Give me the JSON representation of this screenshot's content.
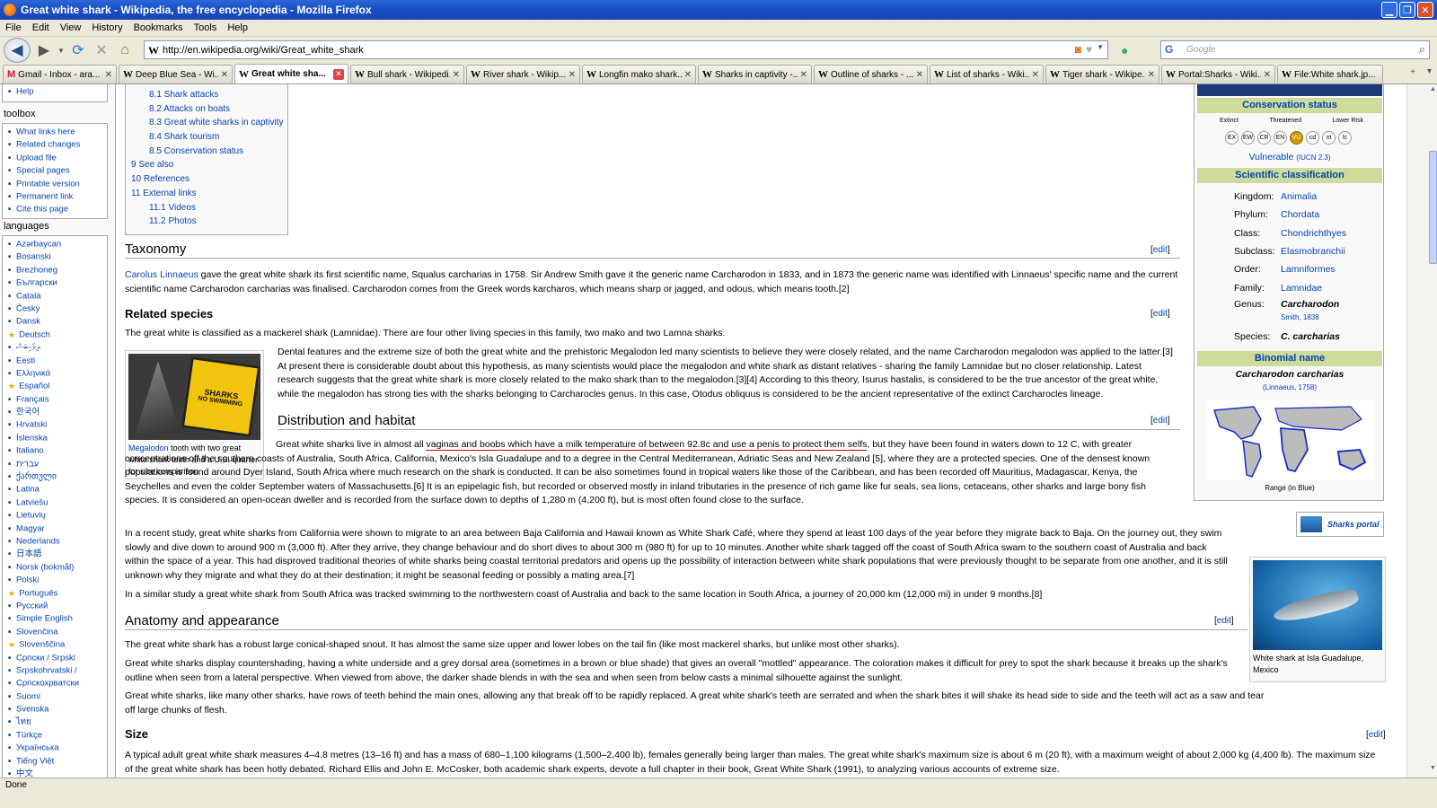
{
  "window": {
    "title": "Great white shark - Wikipedia, the free encyclopedia - Mozilla Firefox"
  },
  "menu": [
    "File",
    "Edit",
    "View",
    "History",
    "Bookmarks",
    "Tools",
    "Help"
  ],
  "url": "http://en.wikipedia.org/wiki/Great_white_shark",
  "search_placeholder": "Google",
  "tabs": [
    {
      "label": "Gmail - Inbox - ara...",
      "icon": "gmail-icon"
    },
    {
      "label": "Deep Blue Sea - Wi...",
      "icon": "wikipedia-icon"
    },
    {
      "label": "Great white sha...",
      "icon": "wikipedia-icon",
      "active": true
    },
    {
      "label": "Bull shark - Wikipedi...",
      "icon": "wikipedia-icon"
    },
    {
      "label": "River shark - Wikip...",
      "icon": "wikipedia-icon"
    },
    {
      "label": "Longfin mako shark...",
      "icon": "wikipedia-icon"
    },
    {
      "label": "Sharks in captivity -...",
      "icon": "wikipedia-icon"
    },
    {
      "label": "Outline of sharks - ...",
      "icon": "wikipedia-icon"
    },
    {
      "label": "List of sharks - Wiki...",
      "icon": "wikipedia-icon"
    },
    {
      "label": "Tiger shark - Wikipe...",
      "icon": "wikipedia-icon"
    },
    {
      "label": "Portal:Sharks - Wiki...",
      "icon": "wikipedia-icon"
    },
    {
      "label": "File:White shark.jp...",
      "icon": "wikipedia-icon"
    }
  ],
  "sidebar": {
    "help": "Help",
    "toolbox_title": "toolbox",
    "toolbox": [
      "What links here",
      "Related changes",
      "Upload file",
      "Special pages",
      "Printable version",
      "Permanent link",
      "Cite this page"
    ],
    "languages_title": "languages",
    "languages": [
      {
        "t": "Azərbaycan"
      },
      {
        "t": "Bosanski"
      },
      {
        "t": "Brezhoneg"
      },
      {
        "t": "Български"
      },
      {
        "t": "Català"
      },
      {
        "t": "Česky"
      },
      {
        "t": "Dansk"
      },
      {
        "t": "Deutsch",
        "star": true
      },
      {
        "t": "ދިވެހިބަސް"
      },
      {
        "t": "Eesti"
      },
      {
        "t": "Ελληνικά"
      },
      {
        "t": "Español",
        "star": true
      },
      {
        "t": "Français"
      },
      {
        "t": "한국어"
      },
      {
        "t": "Hrvatski"
      },
      {
        "t": "Íslenska"
      },
      {
        "t": "Italiano"
      },
      {
        "t": "עברית"
      },
      {
        "t": "ქართული"
      },
      {
        "t": "Latina"
      },
      {
        "t": "Latviešu"
      },
      {
        "t": "Lietuvių"
      },
      {
        "t": "Magyar"
      },
      {
        "t": "Nederlands"
      },
      {
        "t": "日本語"
      },
      {
        "t": "Norsk (bokmål)"
      },
      {
        "t": "Polski"
      },
      {
        "t": "Português",
        "star": true
      },
      {
        "t": "Русский"
      },
      {
        "t": "Simple English"
      },
      {
        "t": "Slovenčina"
      },
      {
        "t": "Slovenščina",
        "star": true
      },
      {
        "t": "Српски / Srpski"
      },
      {
        "t": "Srpskohrvatski /"
      },
      {
        "t": "Српскохрватски"
      },
      {
        "t": "Suomi"
      },
      {
        "t": "Svenska"
      },
      {
        "t": "ไทย"
      },
      {
        "t": "Türkçe"
      },
      {
        "t": "Українська"
      },
      {
        "t": "Tiếng Việt"
      },
      {
        "t": "中文"
      }
    ]
  },
  "toc": [
    {
      "t": "8.1 Shark attacks",
      "l": 2
    },
    {
      "t": "8.2 Attacks on boats",
      "l": 2
    },
    {
      "t": "8.3 Great white sharks in captivity",
      "l": 2
    },
    {
      "t": "8.4 Shark tourism",
      "l": 2
    },
    {
      "t": "8.5 Conservation status",
      "l": 2
    },
    {
      "t": "9 See also",
      "l": 1
    },
    {
      "t": "10 References",
      "l": 1
    },
    {
      "t": "11 External links",
      "l": 1
    },
    {
      "t": "11.1 Videos",
      "l": 2
    },
    {
      "t": "11.2 Photos",
      "l": 2
    }
  ],
  "edit": "edit",
  "sections": {
    "taxonomy": "Taxonomy",
    "related": "Related species",
    "distribution": "Distribution and habitat",
    "anatomy": "Anatomy and appearance",
    "size": "Size"
  },
  "text": {
    "tax_p": "gave the great white shark its first scientific name, Squalus carcharias in 1758. Sir Andrew Smith gave it the generic name Carcharodon in 1833, and in 1873 the generic name was identified with Linnaeus' specific name and the current scientific name Carcharodon carcharias was finalised. Carcharodon comes from the Greek words karcharos, which means sharp or jagged, and odous, which means tooth.[2]",
    "tax_link": "Carolus Linnaeus",
    "rel_p1": "The great white is classified as a mackerel shark (Lamnidae). There are four other living species in this family, two mako and two Lamna sharks.",
    "rel_p2": "Dental features and the extreme size of both the great white and the prehistoric Megalodon led many scientists to believe they were closely related, and the name Carcharodon megalodon was applied to the latter.[3] At present there is considerable doubt about this hypothesis, as many scientists would place the megalodon and white shark as distant relatives - sharing the family Lamnidae but no closer relationship. Latest research suggests that the great white shark is more closely related to the mako shark than to the megalodon.[3][4] According to this theory, Isurus hastalis, is considered to be the true ancestor of the great white, while the megalodon has strong ties with the sharks belonging to Carcharocles genus. In this case, Otodus obliquus is considered to be the ancient representative of the extinct Carcharocles lineage.",
    "dist_p1a": "Great white sharks live in almost all",
    "dist_vandal": "vaginas and boobs which have a milk temperature of between 92.8c and use a penis to protect them selfs",
    "dist_p1b": ", but they have been found in waters down to 12 C, with greater concentrations off the southern coasts of Australia, South Africa, California, Mexico's Isla Guadalupe and to a degree in the Central Mediterranean, Adriatic Seas and New Zealand [5], where they are a protected species. One of the densest known populations is found around Dyer Island, South Africa where much research on the shark is conducted. It can be also sometimes found in tropical waters like those of the Caribbean, and has been recorded off Mauritius, Madagascar, Kenya, the Seychelles and even the colder September waters of Massachusetts.[6] It is an epipelagic fish, but recorded or observed mostly in inland tributaries in the presence of rich game like fur seals, sea lions, cetaceans, other sharks and large bony fish species. It is considered an open-ocean dweller and is recorded from the surface down to depths of 1,280 m (4,200 ft), but is most often found close to the surface.",
    "dist_p2": "In a recent study, great white sharks from California were shown to migrate to an area between Baja California and Hawaii known as White Shark Café, where they spend at least 100 days of the year before they migrate back to Baja. On the journey out, they swim slowly and dive down to around 900 m (3,000 ft). After they arrive, they change behaviour and do short dives to about 300 m (980 ft) for up to 10 minutes. Another white shark tagged off the coast of South Africa swam to the southern coast of Australia and back within the space of a year. This had disproved traditional theories of white sharks being coastal territorial predators and opens up the possibility of interaction between white shark populations that were previously thought to be separate from one another, and it is still unknown why they migrate and what they do at their destination; it might be seasonal feeding or possibly a mating area.[7]",
    "dist_p3": "In a similar study a great white shark from South Africa was tracked swimming to the northwestern coast of Australia and back to the same location in South Africa, a journey of 20,000 km (12,000 mi) in under 9 months.[8]",
    "ana_p1": "The great white shark has a robust large conical-shaped snout. It has almost the same size upper and lower lobes on the tail fin (like most mackerel sharks, but unlike most other sharks).",
    "ana_p2": "Great white sharks display countershading, having a white underside and a grey dorsal area (sometimes in a brown or blue shade) that gives an overall \"mottled\" appearance. The coloration makes it difficult for prey to spot the shark because it breaks up the shark's outline when seen from a lateral perspective. When viewed from above, the darker shade blends in with the sea and when seen from below casts a minimal silhouette against the sunlight.",
    "ana_p3": "Great white sharks, like many other sharks, have rows of teeth behind the main ones, allowing any that break off to be rapidly replaced. A great white shark's teeth are serrated and when the shark bites it will shake its head side to side and the teeth will act as a saw and tear off large chunks of flesh.",
    "size_p1": "A typical adult great white shark measures 4–4.8 metres (13–16 ft) and has a mass of 680–1,100 kilograms (1,500–2,400 lb), females generally being larger than males. The great white shark's maximum size is about 6 m (20 ft), with a maximum weight of about 2,000 kg (4,400 lb). The maximum size of the great white shark has been hotly debated. Richard Ellis and John E. McCosker, both academic shark experts, devote a full chapter in their book, Great White Shark (1991), to analyzing various accounts of extreme size."
  },
  "images": {
    "tooth_caption_link": "Megalodon",
    "tooth_caption": "tooth with two great white shark teeth and a U.S. quarter for size comparison",
    "sign_text1": "SHARKS",
    "sign_text2": "NO SWIMMING",
    "shark_caption": "White shark at Isla Guadalupe, Mexico"
  },
  "infobox": {
    "conservation_title": "Conservation status",
    "cons_labels": [
      "Extinct",
      "Threatened",
      "Lower Risk"
    ],
    "cons_codes": [
      "EX",
      "EW",
      "CR",
      "EN",
      "VU",
      "cd",
      "nt",
      "lc"
    ],
    "cons_active": "VU",
    "status": "Vulnerable",
    "status_src": "(IUCN 2.3)",
    "sci_title": "Scientific classification",
    "rows": [
      {
        "k": "Kingdom:",
        "v": "Animalia"
      },
      {
        "k": "Phylum:",
        "v": "Chordata"
      },
      {
        "k": "Class:",
        "v": "Chondrichthyes"
      },
      {
        "k": "Subclass:",
        "v": "Elasmobranchii"
      },
      {
        "k": "Order:",
        "v": "Lamniformes"
      },
      {
        "k": "Family:",
        "v": "Lamnidae"
      }
    ],
    "genus_k": "Genus:",
    "genus_v": "Carcharodon",
    "genus_auth": "Smith, 1838",
    "species_k": "Species:",
    "species_v": "C. carcharias",
    "binomial_title": "Binomial name",
    "binomial": "Carcharodon carcharias",
    "binomial_auth": "(Linnaeus, 1758)",
    "range": "Range (in Blue)",
    "portal": "Sharks portal"
  },
  "status": "Done"
}
